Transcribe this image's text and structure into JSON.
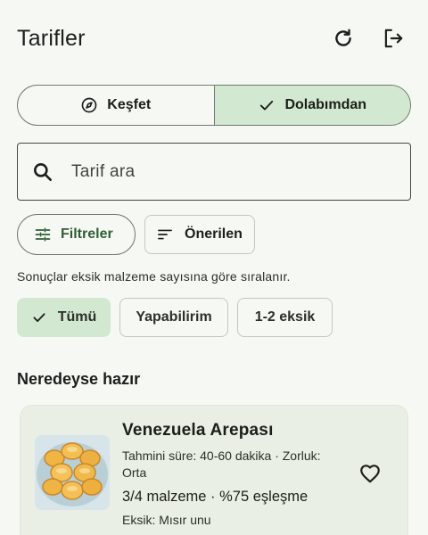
{
  "appbar": {
    "title": "Tarifler",
    "refresh_icon": "refresh-icon",
    "logout_icon": "logout-icon"
  },
  "mode_tabs": [
    {
      "label": "Keşfet",
      "icon": "compass-icon",
      "selected": false
    },
    {
      "label": "Dolabımdan",
      "icon": "check-icon",
      "selected": true
    }
  ],
  "search": {
    "placeholder": "Tarif ara",
    "value": ""
  },
  "actions": {
    "filters_label": "Filtreler",
    "sort_label": "Önerilen"
  },
  "hint": "Sonuçlar eksik malzeme sayısına göre sıralanır.",
  "chips": [
    {
      "label": "Tümü",
      "selected": true
    },
    {
      "label": "Yapabilirim",
      "selected": false
    },
    {
      "label": "1-2 eksik",
      "selected": false
    }
  ],
  "section_title": "Neredeyse hazır",
  "recipes": [
    {
      "name": "Venezuela Arepası",
      "meta": "Tahmini süre: 40-60 dakika · Zorluk: Orta",
      "match": "3/4 malzeme · %75 eşleşme",
      "missing": "Eksik: Mısır unu",
      "favorite": false
    }
  ],
  "colors": {
    "background": "#f6f9f3",
    "selected_container": "#d3e8d0",
    "primary": "#2f5e35",
    "card": "#eaefe5"
  }
}
